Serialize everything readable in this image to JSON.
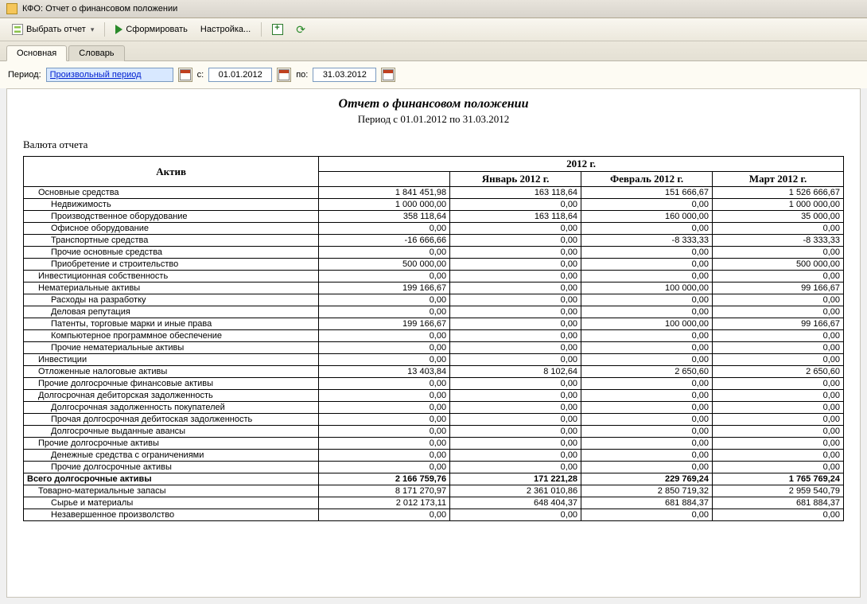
{
  "window": {
    "title": "КФО: Отчет о финансовом положении"
  },
  "toolbar": {
    "select_report": "Выбрать отчет",
    "generate": "Сформировать",
    "settings": "Настройка..."
  },
  "tabs": {
    "main": "Основная",
    "dict": "Словарь"
  },
  "period": {
    "label": "Период:",
    "type": "Произвольный период",
    "from_label": "с:",
    "from": "01.01.2012",
    "to_label": "по:",
    "to": "31.03.2012"
  },
  "report": {
    "title": "Отчет о финансовом положении",
    "subtitle": "Период с 01.01.2012 по 31.03.2012",
    "currency_label": "Валюта отчета",
    "header": {
      "asset": "Актив",
      "year": "2012 г.",
      "months": [
        "Январь 2012 г.",
        "Февраль 2012 г.",
        "Март 2012 г."
      ]
    },
    "rows": [
      {
        "label": "Основные средства",
        "ind": 1,
        "v": [
          "1 841 451,98",
          "163 118,64",
          "151 666,67",
          "1 526 666,67"
        ]
      },
      {
        "label": "Недвижимость",
        "ind": 2,
        "v": [
          "1 000 000,00",
          "0,00",
          "0,00",
          "1 000 000,00"
        ]
      },
      {
        "label": "Производственное оборудование",
        "ind": 2,
        "v": [
          "358 118,64",
          "163 118,64",
          "160 000,00",
          "35 000,00"
        ]
      },
      {
        "label": "Офисное оборудование",
        "ind": 2,
        "v": [
          "0,00",
          "0,00",
          "0,00",
          "0,00"
        ]
      },
      {
        "label": "Транспортные средства",
        "ind": 2,
        "v": [
          "-16 666,66",
          "0,00",
          "-8 333,33",
          "-8 333,33"
        ]
      },
      {
        "label": "Прочие основные средства",
        "ind": 2,
        "v": [
          "0,00",
          "0,00",
          "0,00",
          "0,00"
        ]
      },
      {
        "label": "Приобретение и строительство",
        "ind": 2,
        "v": [
          "500 000,00",
          "0,00",
          "0,00",
          "500 000,00"
        ]
      },
      {
        "label": "Инвестиционная собственность",
        "ind": 1,
        "v": [
          "0,00",
          "0,00",
          "0,00",
          "0,00"
        ]
      },
      {
        "label": "Нематериальные активы",
        "ind": 1,
        "v": [
          "199 166,67",
          "0,00",
          "100 000,00",
          "99 166,67"
        ]
      },
      {
        "label": "Расходы на разработку",
        "ind": 2,
        "v": [
          "0,00",
          "0,00",
          "0,00",
          "0,00"
        ]
      },
      {
        "label": "Деловая репутация",
        "ind": 2,
        "v": [
          "0,00",
          "0,00",
          "0,00",
          "0,00"
        ]
      },
      {
        "label": "Патенты, торговые марки и иные права",
        "ind": 2,
        "v": [
          "199 166,67",
          "0,00",
          "100 000,00",
          "99 166,67"
        ]
      },
      {
        "label": "Компьютерное программное обеспечение",
        "ind": 2,
        "v": [
          "0,00",
          "0,00",
          "0,00",
          "0,00"
        ]
      },
      {
        "label": "Прочие нематериальные активы",
        "ind": 2,
        "v": [
          "0,00",
          "0,00",
          "0,00",
          "0,00"
        ]
      },
      {
        "label": "Инвестиции",
        "ind": 1,
        "v": [
          "0,00",
          "0,00",
          "0,00",
          "0,00"
        ]
      },
      {
        "label": "Отложенные налоговые активы",
        "ind": 1,
        "v": [
          "13 403,84",
          "8 102,64",
          "2 650,60",
          "2 650,60"
        ]
      },
      {
        "label": "Прочие долгосрочные финансовые активы",
        "ind": 1,
        "v": [
          "0,00",
          "0,00",
          "0,00",
          "0,00"
        ]
      },
      {
        "label": "Долгосрочная дебиторская задолженность",
        "ind": 1,
        "v": [
          "0,00",
          "0,00",
          "0,00",
          "0,00"
        ]
      },
      {
        "label": "Долгосрочная задолженность покупателей",
        "ind": 2,
        "v": [
          "0,00",
          "0,00",
          "0,00",
          "0,00"
        ]
      },
      {
        "label": "Прочая долгосрочная дебитоская задолженность",
        "ind": 2,
        "v": [
          "0,00",
          "0,00",
          "0,00",
          "0,00"
        ]
      },
      {
        "label": "Долгосрочные выданные авансы",
        "ind": 2,
        "v": [
          "0,00",
          "0,00",
          "0,00",
          "0,00"
        ]
      },
      {
        "label": "Прочие долгосрочные активы",
        "ind": 1,
        "v": [
          "0,00",
          "0,00",
          "0,00",
          "0,00"
        ]
      },
      {
        "label": "Денежные средства с ограничениями",
        "ind": 2,
        "v": [
          "0,00",
          "0,00",
          "0,00",
          "0,00"
        ]
      },
      {
        "label": "Прочие долгосрочные активы",
        "ind": 2,
        "v": [
          "0,00",
          "0,00",
          "0,00",
          "0,00"
        ]
      },
      {
        "label": "Всего долгосрочные активы",
        "ind": 0,
        "bold": true,
        "v": [
          "2 166 759,76",
          "171 221,28",
          "229 769,24",
          "1 765 769,24"
        ]
      },
      {
        "label": "Товарно-материальные запасы",
        "ind": 1,
        "v": [
          "8 171 270,97",
          "2 361 010,86",
          "2 850 719,32",
          "2 959 540,79"
        ]
      },
      {
        "label": "Сырье и материалы",
        "ind": 2,
        "v": [
          "2 012 173,11",
          "648 404,37",
          "681 884,37",
          "681 884,37"
        ]
      },
      {
        "label": "Незавершенное произволство",
        "ind": 2,
        "v": [
          "0,00",
          "0,00",
          "0,00",
          "0,00"
        ]
      }
    ]
  }
}
